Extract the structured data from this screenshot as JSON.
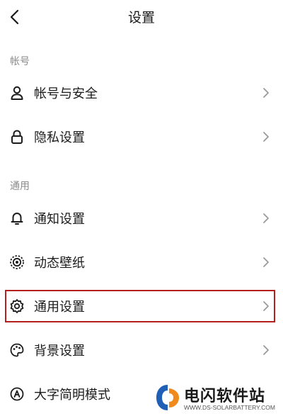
{
  "header": {
    "title": "设置",
    "back_icon": "chevron-left-icon"
  },
  "sections": [
    {
      "label": "帐号",
      "items": [
        {
          "label": "帐号与安全",
          "icon": "user-icon"
        },
        {
          "label": "隐私设置",
          "icon": "lock-icon"
        }
      ]
    },
    {
      "label": "通用",
      "items": [
        {
          "label": "通知设置",
          "icon": "bell-icon"
        },
        {
          "label": "动态壁纸",
          "icon": "live-wallpaper-icon"
        },
        {
          "label": "通用设置",
          "icon": "gear-icon",
          "highlighted": true
        },
        {
          "label": "背景设置",
          "icon": "palette-icon"
        },
        {
          "label": "大字简明模式",
          "icon": "font-mode-icon"
        }
      ]
    }
  ],
  "highlight_color": "#b3201f",
  "watermark": {
    "title": "电闪软件站",
    "url": "WWW.DS-SOLARBATTERY.COM",
    "colors": [
      "#1f5fb5",
      "#f08a1c"
    ]
  }
}
